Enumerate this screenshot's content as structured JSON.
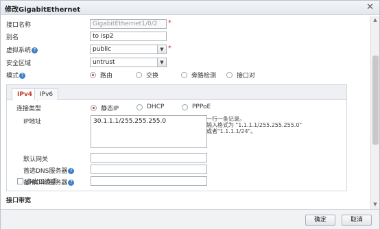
{
  "window": {
    "title": "修改GigabitEthernet"
  },
  "form": {
    "interface_name": {
      "label": "接口名称",
      "value": "GigabitEthernet1/0/2"
    },
    "alias": {
      "label": "别名",
      "value": "to isp2"
    },
    "vsys": {
      "label": "虚拟系统",
      "value": "public"
    },
    "zone": {
      "label": "安全区域",
      "value": "untrust"
    },
    "mode": {
      "label": "模式",
      "options": [
        "路由",
        "交换",
        "旁路检测",
        "接口对"
      ],
      "selected": "路由"
    }
  },
  "tabs": [
    {
      "label": "IPv4",
      "active": true
    },
    {
      "label": "IPv6",
      "active": false
    }
  ],
  "ipv4": {
    "conn_type": {
      "label": "连接类型",
      "options": [
        "静态IP",
        "DHCP",
        "PPPoE"
      ],
      "selected": "静态IP"
    },
    "ip_address": {
      "label": "IP地址",
      "value": "30.1.1.1/255.255.255.0"
    },
    "hint": "一行一条记录。\n输入格式为 \"1.1.1.1/255.255.255.0\"\n或者\"1.1.1.1/24\"。",
    "gateway": {
      "label": "默认网关",
      "value": ""
    },
    "dns_primary": {
      "label": "首选DNS服务器",
      "value": ""
    },
    "dns_secondary": {
      "label": "备用DNS服务器",
      "value": ""
    },
    "multi_egress": {
      "label": "多出口选项",
      "checked": false
    }
  },
  "section_bandwidth": "接口带宽",
  "buttons": {
    "ok": "确定",
    "cancel": "取消"
  },
  "icons": {
    "help": "?",
    "close": "✕",
    "dropdown": "▼"
  },
  "colors": {
    "accent": "#c0392b",
    "help_blue": "#3d7fc9",
    "required": "#dd2222"
  }
}
